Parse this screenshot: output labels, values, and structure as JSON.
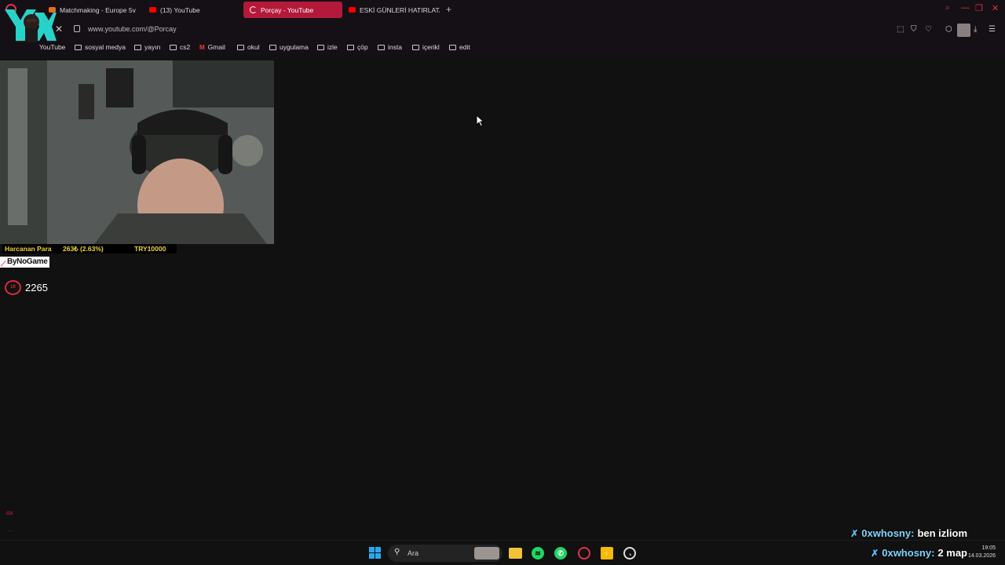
{
  "browser": {
    "tabs": [
      {
        "title": "Matchmaking - Europe 5v",
        "fav_color": "#e86c1e",
        "active": false
      },
      {
        "title": "(13) YouTube",
        "fav_color": "#ff0000",
        "active": false
      },
      {
        "title": "Porçay - YouTube",
        "fav_color": "#ffffff",
        "active": true
      },
      {
        "title": "ESKİ GÜNLERİ HATIRLATAN",
        "fav_color": "#ff0000",
        "active": false
      }
    ],
    "new_tab": "+",
    "url": "www.youtube.com/@Porcay",
    "bookmarks": [
      {
        "label": "YouTube",
        "type": "site"
      },
      {
        "label": "sosyal medya",
        "type": "folder"
      },
      {
        "label": "yayın",
        "type": "folder"
      },
      {
        "label": "cs2",
        "type": "folder"
      },
      {
        "label": "Gmail",
        "type": "gmail"
      },
      {
        "label": "okul",
        "type": "folder"
      },
      {
        "label": "uygulama",
        "type": "folder"
      },
      {
        "label": "izle",
        "type": "folder"
      },
      {
        "label": "çöp",
        "type": "folder"
      },
      {
        "label": "insta",
        "type": "folder"
      },
      {
        "label": "içerikl",
        "type": "folder"
      },
      {
        "label": "edit",
        "type": "folder"
      }
    ]
  },
  "overlay": {
    "money_label": "Harcanan Para",
    "money_value": "263₺ (2.63%)",
    "money_total": "TRY10000",
    "sponsor": "ByNoGame",
    "level": "10",
    "elo": "2265"
  },
  "chat": [
    {
      "user": "0xwhosny:",
      "message": "ben izliom"
    },
    {
      "user": "0xwhosny:",
      "message": "2 map"
    }
  ],
  "taskbar": {
    "search_placeholder": "Ara",
    "time": "19:05",
    "date": "14.03.2026"
  },
  "colors": {
    "accent": "#b3193a",
    "opera_red": "#e0334a",
    "background": "#111111",
    "money_text": "#f0d235"
  }
}
